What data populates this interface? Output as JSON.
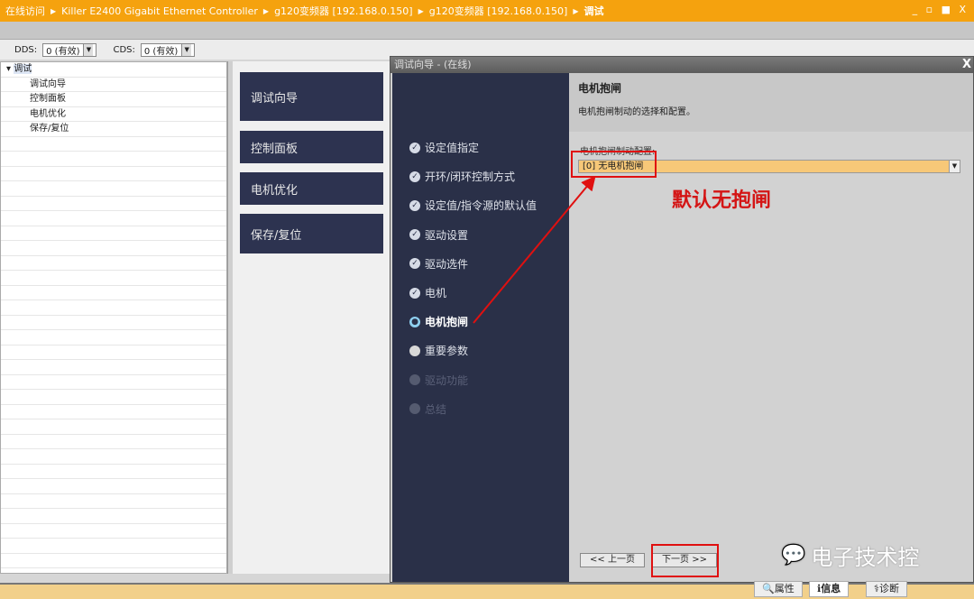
{
  "titlebar": {
    "crumbs": [
      "在线访问",
      "Killer E2400 Gigabit Ethernet Controller",
      "g120变频器 [192.168.0.150]",
      "g120变频器 [192.168.0.150]",
      "调试"
    ],
    "window_controls": "_ ▫ ■ X"
  },
  "selectors": {
    "dds_label": "DDS:",
    "dds_value": "0 (有效)",
    "cds_label": "CDS:",
    "cds_value": "0 (有效)"
  },
  "tree": {
    "root": "调试",
    "items": [
      "调试向导",
      "控制面板",
      "电机优化",
      "保存/复位"
    ]
  },
  "middle": {
    "buttons": [
      "调试向导",
      "控制面板",
      "电机优化",
      "保存/复位"
    ]
  },
  "dialog": {
    "title": "调试向导 - (在线)",
    "close": "X",
    "steps": [
      {
        "label": "设定值指定",
        "state": "done"
      },
      {
        "label": "开环/闭环控制方式",
        "state": "done"
      },
      {
        "label": "设定值/指令源的默认值",
        "state": "done"
      },
      {
        "label": "驱动设置",
        "state": "done"
      },
      {
        "label": "驱动选件",
        "state": "done"
      },
      {
        "label": "电机",
        "state": "done"
      },
      {
        "label": "电机抱闸",
        "state": "active"
      },
      {
        "label": "重要参数",
        "state": "todo"
      },
      {
        "label": "驱动功能",
        "state": "disabled"
      },
      {
        "label": "总结",
        "state": "disabled"
      }
    ],
    "header_title": "电机抱闸",
    "header_desc": "电机抱闸制动的选择和配置。",
    "config_label": "电机抱闸制动配置:",
    "config_value": "[0] 无电机抱闸",
    "prev": "<< 上一页",
    "next": "下一页 >>"
  },
  "annotation": {
    "text": "默认无抱闸",
    "color": "#d41515"
  },
  "watermark": "电子技术控",
  "bottom_tabs": [
    "属性",
    "信息",
    "诊断"
  ]
}
